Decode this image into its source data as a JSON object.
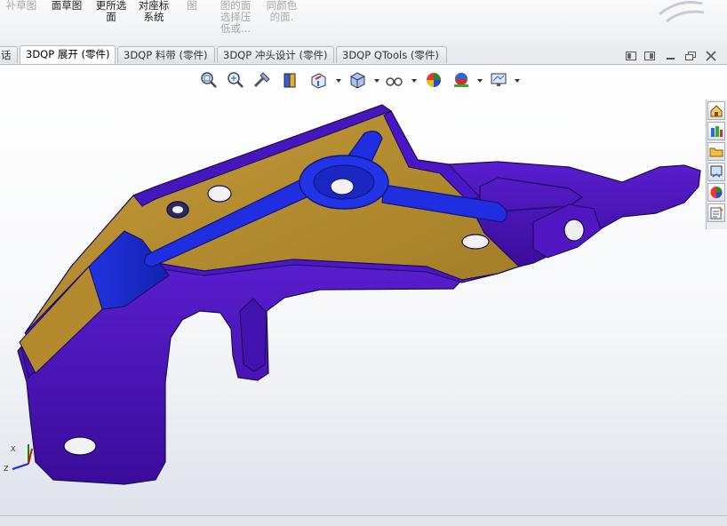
{
  "ribbon": {
    "items": [
      {
        "label": "补草图",
        "dim": true
      },
      {
        "label": "面草图",
        "dim": false
      },
      {
        "label": "更所选\n面",
        "dim": false
      },
      {
        "label": "对座标\n系统",
        "dim": false
      },
      {
        "label": "图",
        "dim": true
      },
      {
        "label": "图的面\n选择压\n低或...",
        "dim": true
      },
      {
        "label": "同颜色\n的面.",
        "dim": true
      }
    ]
  },
  "tabs": [
    {
      "label": "话",
      "active": false
    },
    {
      "label": "3DQP 展开 (零件)",
      "active": true
    },
    {
      "label": "3DQP 料带 (零件)",
      "active": false
    },
    {
      "label": "3DQP 冲头设计 (零件)",
      "active": false
    },
    {
      "label": "3DQP QTools (零件)",
      "active": false
    }
  ],
  "window_controls": [
    "tile-horizontal-icon",
    "tile-vertical-icon",
    "restore-icon",
    "close-icon"
  ],
  "view_toolbar": [
    "zoom-to-fit-icon",
    "zoom-area-icon",
    "previous-view-icon",
    "section-view-icon",
    "view-orientation-icon",
    "display-style-icon",
    "hide-show-icon",
    "edit-appearance-icon",
    "apply-scene-icon",
    "view-settings-icon"
  ],
  "task_pane": [
    "home-icon",
    "design-library-icon",
    "file-explorer-icon",
    "view-palette-icon",
    "appearances-icon",
    "custom-properties-icon"
  ],
  "colors": {
    "part_purple": "#4a12b8",
    "part_gold": "#b38a2e",
    "part_blue": "#1c2fd4",
    "edge_dark": "#1a0a55"
  },
  "triad": {
    "x": "X",
    "z": "Z"
  }
}
